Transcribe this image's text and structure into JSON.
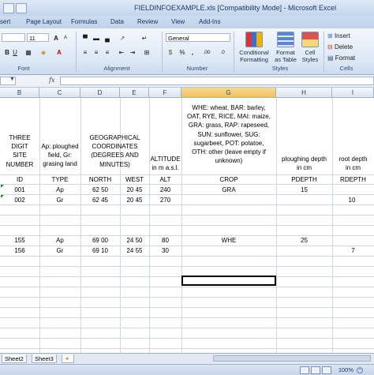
{
  "window": {
    "title": "FIELDINFOEXAMPLE.xls  [Compatibility Mode] - Microsoft Excel"
  },
  "ribbon_tabs": [
    "sert",
    "Page Layout",
    "Formulas",
    "Data",
    "Review",
    "View",
    "Add-Ins"
  ],
  "ribbon": {
    "font_name": "",
    "font_size": "11",
    "number_format": "General",
    "group_labels": {
      "font": "Font",
      "alignment": "Alignment",
      "number": "Number",
      "styles": "Styles",
      "cells": "Cells"
    },
    "styles_buttons": {
      "conditional": "Conditional\nFormatting",
      "format_table": "Format\nas Table",
      "cell_styles": "Cell\nStyles"
    },
    "cells_buttons": {
      "insert": "Insert",
      "delete": "Delete",
      "format": "Format"
    },
    "percent": "%",
    "comma": ",",
    "decimals_inc": ".00",
    "decimals_dec": ".0",
    "currency": "$"
  },
  "formula_bar": {
    "fx": "fx",
    "value": ""
  },
  "grid": {
    "columns": [
      "B",
      "C",
      "D",
      "E",
      "F",
      "G",
      "H",
      "I"
    ],
    "selected_column": "G",
    "header_rows": {
      "B": "THREE\nDIGIT\nSITE\nNUMBER",
      "C": "Ap: ploughed\nfield, Gr:\ngrasing land",
      "DE": "GEOGRAPHICAL\nCOORDINATES\n(DEGREES AND\nMINUTES)",
      "F": "ALTITUDE\nin m a.s.l.",
      "G": "WHE: wheat, BAR: barley,\nOAT, RYE, RICE, MAI: maize,\nGRA: grass, RAP: rapeseed,\nSUN: sunflower, SUG:\nsugarbeet, POT: potatoe,\nOTH: other (leave empty if\nunknown)",
      "H": "ploughing depth\nin cm",
      "I": "root depth\nin cm"
    },
    "field_row": [
      "ID",
      "TYPE",
      "NORTH",
      "WEST",
      "ALT",
      "CROP",
      "PDEPTH",
      "RDEPTH"
    ],
    "data_rows": [
      [
        "001",
        "Ap",
        "62 50",
        "20 45",
        "240",
        "GRA",
        "15",
        ""
      ],
      [
        "002",
        "Gr",
        "62 45",
        "20 45",
        "270",
        "",
        "",
        "10"
      ],
      [
        "",
        "",
        "",
        "",
        "",
        "",
        "",
        ""
      ],
      [
        "",
        "",
        "",
        "",
        "",
        "",
        "",
        ""
      ],
      [
        "155",
        "Ap",
        "69 00",
        "24 50",
        "80",
        "WHE",
        "25",
        ""
      ],
      [
        "156",
        "Gr",
        "69 10",
        "24 55",
        "30",
        "",
        "",
        "7"
      ]
    ]
  },
  "sheet_tabs": [
    "Sheet2",
    "Sheet3"
  ],
  "status": {
    "zoom": "100%"
  },
  "colors": {
    "selected_header": "#f1c15f",
    "error_indicator": "#1e8a2f",
    "ribbon_bg": "#dde8f6"
  }
}
